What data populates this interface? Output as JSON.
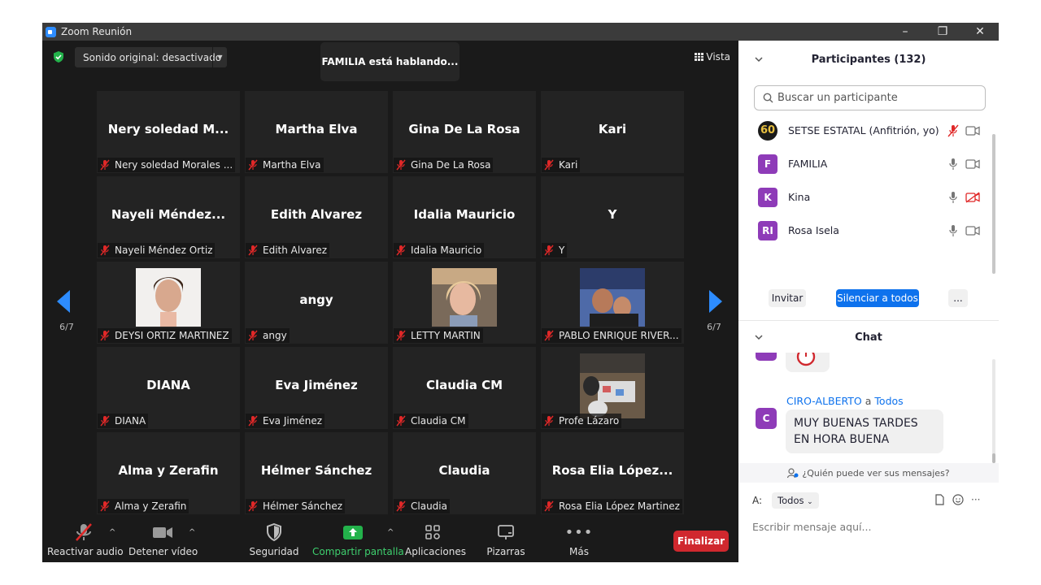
{
  "window": {
    "title": "Zoom Reunión",
    "controls": [
      "–",
      "❐",
      "✕"
    ]
  },
  "top": {
    "original_sound": "Sonido original: desactivado",
    "speaking": "FAMILIA está hablando...",
    "view": "Vista"
  },
  "pager": {
    "left": "6/7",
    "right": "6/7"
  },
  "tiles": [
    {
      "big": "Nery soledad M...",
      "name": "Nery soledad Morales ..."
    },
    {
      "big": "Martha Elva",
      "name": "Martha Elva"
    },
    {
      "big": "Gina De La Rosa",
      "name": "Gina De La Rosa"
    },
    {
      "big": "Kari",
      "name": "Kari"
    },
    {
      "big": "Nayeli  Méndez...",
      "name": "Nayeli Méndez Ortiz"
    },
    {
      "big": "Edith Alvarez",
      "name": "Edith Alvarez"
    },
    {
      "big": "Idalia Mauricio",
      "name": "Idalia Mauricio"
    },
    {
      "big": "Y",
      "name": "Y"
    },
    {
      "big": "",
      "name": "DEYSI ORTIZ MARTINEZ",
      "photo": "woman-selfie"
    },
    {
      "big": "angy",
      "name": "angy"
    },
    {
      "big": "",
      "name": "LETTY MARTIN",
      "photo": "woman-blonde"
    },
    {
      "big": "",
      "name": "PABLO ENRIQUE RIVER...",
      "photo": "couple"
    },
    {
      "big": "DIANA",
      "name": "DIANA"
    },
    {
      "big": "Eva Jiménez",
      "name": "Eva Jiménez"
    },
    {
      "big": "Claudia CM",
      "name": "Claudia CM"
    },
    {
      "big": "",
      "name": "Profe Lázaro",
      "photo": "children"
    },
    {
      "big": "Alma y Zerafin",
      "name": "Alma y Zerafin"
    },
    {
      "big": "Hélmer Sánchez",
      "name": "Hélmer Sánchez"
    },
    {
      "big": "Claudia",
      "name": "Claudia"
    },
    {
      "big": "Rosa Elia López...",
      "name": "Rosa Elia López Martinez"
    }
  ],
  "toolbar": {
    "unmute": "Reactivar audio",
    "stop_video": "Detener vídeo",
    "security": "Seguridad",
    "share": "Compartir pantalla",
    "apps": "Aplicaciones",
    "whiteboards": "Pizarras",
    "more": "Más",
    "end": "Finalizar"
  },
  "participants": {
    "header": "Participantes (132)",
    "search_placeholder": "Buscar un participante",
    "list": [
      {
        "initials": "60",
        "name": "SETSE ESTATAL (Anfitrión, yo)",
        "mic": "muted",
        "cam": "on"
      },
      {
        "initials": "F",
        "name": "FAMILIA",
        "mic": "on",
        "cam": "on"
      },
      {
        "initials": "K",
        "name": "Kina",
        "mic": "on",
        "cam": "off"
      },
      {
        "initials": "RI",
        "name": "Rosa Isela",
        "mic": "on",
        "cam": "on"
      }
    ],
    "invite": "Invitar",
    "mute_all": "Silenciar a todos",
    "more": "..."
  },
  "chat": {
    "header": "Chat",
    "message": {
      "avatar": "C",
      "sender": "CIRO-ALBERTO",
      "to_word": "a",
      "to": "Todos",
      "text": "MUY BUENAS TARDES EN HORA BUENA"
    },
    "who_can_see": "¿Quién puede ver sus mensajes?",
    "to_label": "A:",
    "recipient": "Todos",
    "input_placeholder": "Escribir mensaje aquí..."
  },
  "colors": {
    "accent": "#0e72ed",
    "end": "#d0282e",
    "share": "#3ecf6e",
    "avatar": "#8e3bb8",
    "muted": "#e02828"
  }
}
